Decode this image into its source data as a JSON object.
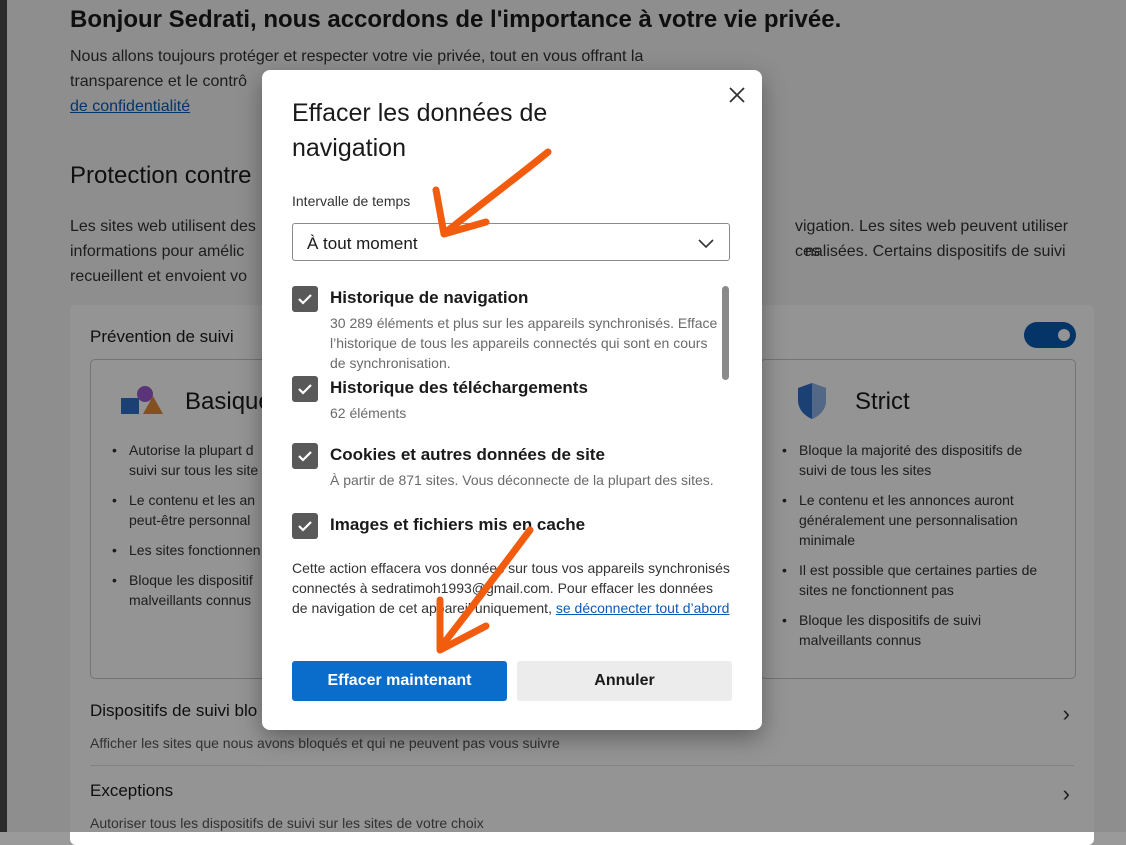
{
  "page": {
    "greeting": "Bonjour Sedrati, nous accordons de l'importance à votre vie privée.",
    "intro_line1": "Nous allons toujours protéger et respecter votre vie privée, tout en vous offrant la",
    "intro_line2": "transparence et le contrô",
    "intro_link": "de confidentialité",
    "protection_title": "Protection contre",
    "protection_desc_line1_left": "Les sites web utilisent des",
    "protection_desc_line1_right": "vigation. Les sites web peuvent utiliser ces",
    "protection_desc_line2_left": "informations pour amélic",
    "protection_desc_line2_right": "nalisées. Certains dispositifs de suivi",
    "protection_desc_line3_left": "recueillent et envoient vo",
    "tracking_title": "Prévention de suivi",
    "basic": {
      "name": "Basique",
      "items": [
        "Autorise la plupart d\nsuivi sur tous les site",
        "Le contenu et les an\npeut-être personnal",
        "Les sites fonctionnen",
        "Bloque les dispositif\nmalveillants connus"
      ]
    },
    "strict": {
      "name": "Strict",
      "items": [
        "Bloque la majorité des dispositifs de\nsuivi de tous les sites",
        "Le contenu et les annonces auront\ngénéralement une personnalisation\nminimale",
        "Il est possible que certaines parties de\nsites ne fonctionnent pas",
        "Bloque les dispositifs de suivi\nmalveillants connus"
      ]
    },
    "blocked_title": "Dispositifs de suivi blo",
    "blocked_sub": "Afficher les sites que nous avons bloqués et qui ne peuvent pas vous suivre",
    "exceptions_title": "Exceptions",
    "exceptions_sub": "Autoriser tous les dispositifs de suivi sur les sites de votre choix"
  },
  "dialog": {
    "title": "Effacer les données de navigation",
    "range_label": "Intervalle de temps",
    "range_value": "À tout moment",
    "items": [
      {
        "title": "Historique de navigation",
        "sub": "30 289 éléments et plus sur les appareils synchronisés. Efface l’historique de tous les appareils connectés qui sont en cours de synchronisation.",
        "checked": true
      },
      {
        "title": "Historique des téléchargements",
        "sub": "62 éléments",
        "checked": true
      },
      {
        "title": "Cookies et autres données de site",
        "sub": "À partir de 871 sites. Vous déconnecte de la plupart des sites.",
        "checked": true
      },
      {
        "title": "Images et fichiers mis en cache",
        "sub": "",
        "checked": true
      }
    ],
    "notice_text": "Cette action effacera vos données sur tous vos appareils synchronisés connectés à sedratimoh1993@gmail.com. Pour effacer les données de navigation de cet appareil uniquement, ",
    "notice_link": "se déconnecter tout d’abord",
    "primary_button": "Effacer maintenant",
    "secondary_button": "Annuler"
  },
  "colors": {
    "accent": "#0a6dcc",
    "annotation_arrow": "#f25c0f"
  }
}
